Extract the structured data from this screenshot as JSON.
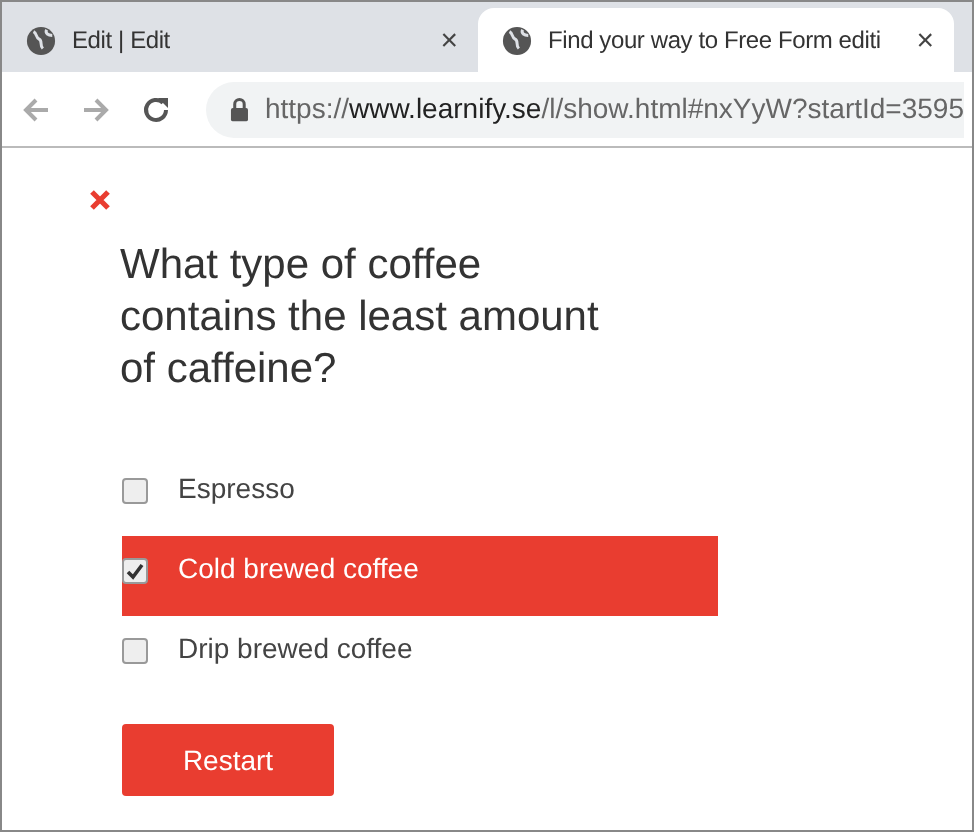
{
  "browser": {
    "tabs": [
      {
        "title": "Edit | Edit",
        "selected": false,
        "close": "×"
      },
      {
        "title": "Find your way to Free Form editi",
        "selected": true,
        "close": "×"
      }
    ],
    "url": {
      "scheme": "https://",
      "host": "www.learnify.se",
      "path": "/l/show.html#nxYyW?startId=3595"
    }
  },
  "quiz": {
    "question": "What type of coffee contains the least amount of caffeine?",
    "options": [
      {
        "label": "Espresso",
        "checked": false
      },
      {
        "label": "Cold brewed coffee",
        "checked": true
      },
      {
        "label": "Drip brewed coffee",
        "checked": false
      }
    ],
    "button": "Restart"
  }
}
